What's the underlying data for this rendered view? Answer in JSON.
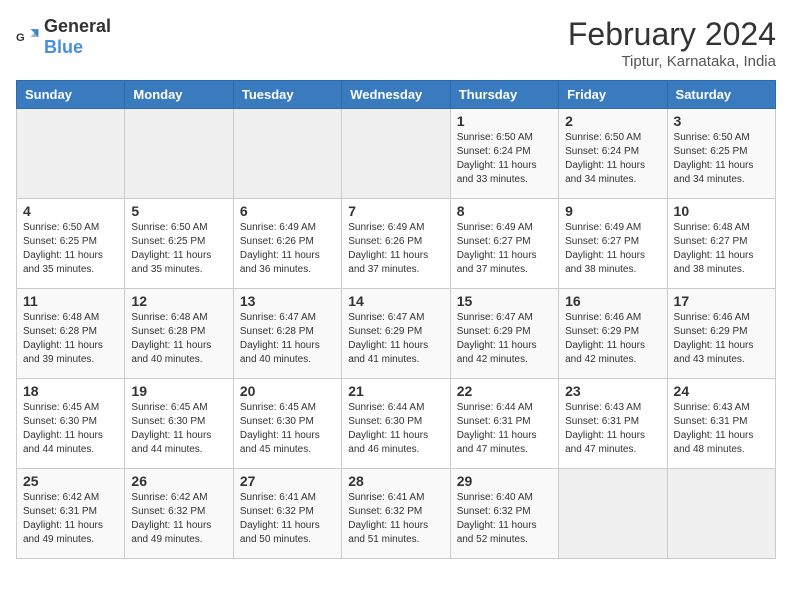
{
  "header": {
    "logo_general": "General",
    "logo_blue": "Blue",
    "title": "February 2024",
    "subtitle": "Tiptur, Karnataka, India"
  },
  "weekdays": [
    "Sunday",
    "Monday",
    "Tuesday",
    "Wednesday",
    "Thursday",
    "Friday",
    "Saturday"
  ],
  "weeks": [
    [
      {
        "day": "",
        "empty": true
      },
      {
        "day": "",
        "empty": true
      },
      {
        "day": "",
        "empty": true
      },
      {
        "day": "",
        "empty": true
      },
      {
        "day": "1",
        "sunrise": "6:50 AM",
        "sunset": "6:24 PM",
        "daylight": "11 hours and 33 minutes."
      },
      {
        "day": "2",
        "sunrise": "6:50 AM",
        "sunset": "6:24 PM",
        "daylight": "11 hours and 34 minutes."
      },
      {
        "day": "3",
        "sunrise": "6:50 AM",
        "sunset": "6:25 PM",
        "daylight": "11 hours and 34 minutes."
      }
    ],
    [
      {
        "day": "4",
        "sunrise": "6:50 AM",
        "sunset": "6:25 PM",
        "daylight": "11 hours and 35 minutes."
      },
      {
        "day": "5",
        "sunrise": "6:50 AM",
        "sunset": "6:25 PM",
        "daylight": "11 hours and 35 minutes."
      },
      {
        "day": "6",
        "sunrise": "6:49 AM",
        "sunset": "6:26 PM",
        "daylight": "11 hours and 36 minutes."
      },
      {
        "day": "7",
        "sunrise": "6:49 AM",
        "sunset": "6:26 PM",
        "daylight": "11 hours and 37 minutes."
      },
      {
        "day": "8",
        "sunrise": "6:49 AM",
        "sunset": "6:27 PM",
        "daylight": "11 hours and 37 minutes."
      },
      {
        "day": "9",
        "sunrise": "6:49 AM",
        "sunset": "6:27 PM",
        "daylight": "11 hours and 38 minutes."
      },
      {
        "day": "10",
        "sunrise": "6:48 AM",
        "sunset": "6:27 PM",
        "daylight": "11 hours and 38 minutes."
      }
    ],
    [
      {
        "day": "11",
        "sunrise": "6:48 AM",
        "sunset": "6:28 PM",
        "daylight": "11 hours and 39 minutes."
      },
      {
        "day": "12",
        "sunrise": "6:48 AM",
        "sunset": "6:28 PM",
        "daylight": "11 hours and 40 minutes."
      },
      {
        "day": "13",
        "sunrise": "6:47 AM",
        "sunset": "6:28 PM",
        "daylight": "11 hours and 40 minutes."
      },
      {
        "day": "14",
        "sunrise": "6:47 AM",
        "sunset": "6:29 PM",
        "daylight": "11 hours and 41 minutes."
      },
      {
        "day": "15",
        "sunrise": "6:47 AM",
        "sunset": "6:29 PM",
        "daylight": "11 hours and 42 minutes."
      },
      {
        "day": "16",
        "sunrise": "6:46 AM",
        "sunset": "6:29 PM",
        "daylight": "11 hours and 42 minutes."
      },
      {
        "day": "17",
        "sunrise": "6:46 AM",
        "sunset": "6:29 PM",
        "daylight": "11 hours and 43 minutes."
      }
    ],
    [
      {
        "day": "18",
        "sunrise": "6:45 AM",
        "sunset": "6:30 PM",
        "daylight": "11 hours and 44 minutes."
      },
      {
        "day": "19",
        "sunrise": "6:45 AM",
        "sunset": "6:30 PM",
        "daylight": "11 hours and 44 minutes."
      },
      {
        "day": "20",
        "sunrise": "6:45 AM",
        "sunset": "6:30 PM",
        "daylight": "11 hours and 45 minutes."
      },
      {
        "day": "21",
        "sunrise": "6:44 AM",
        "sunset": "6:30 PM",
        "daylight": "11 hours and 46 minutes."
      },
      {
        "day": "22",
        "sunrise": "6:44 AM",
        "sunset": "6:31 PM",
        "daylight": "11 hours and 47 minutes."
      },
      {
        "day": "23",
        "sunrise": "6:43 AM",
        "sunset": "6:31 PM",
        "daylight": "11 hours and 47 minutes."
      },
      {
        "day": "24",
        "sunrise": "6:43 AM",
        "sunset": "6:31 PM",
        "daylight": "11 hours and 48 minutes."
      }
    ],
    [
      {
        "day": "25",
        "sunrise": "6:42 AM",
        "sunset": "6:31 PM",
        "daylight": "11 hours and 49 minutes."
      },
      {
        "day": "26",
        "sunrise": "6:42 AM",
        "sunset": "6:32 PM",
        "daylight": "11 hours and 49 minutes."
      },
      {
        "day": "27",
        "sunrise": "6:41 AM",
        "sunset": "6:32 PM",
        "daylight": "11 hours and 50 minutes."
      },
      {
        "day": "28",
        "sunrise": "6:41 AM",
        "sunset": "6:32 PM",
        "daylight": "11 hours and 51 minutes."
      },
      {
        "day": "29",
        "sunrise": "6:40 AM",
        "sunset": "6:32 PM",
        "daylight": "11 hours and 52 minutes."
      },
      {
        "day": "",
        "empty": true
      },
      {
        "day": "",
        "empty": true
      }
    ]
  ]
}
